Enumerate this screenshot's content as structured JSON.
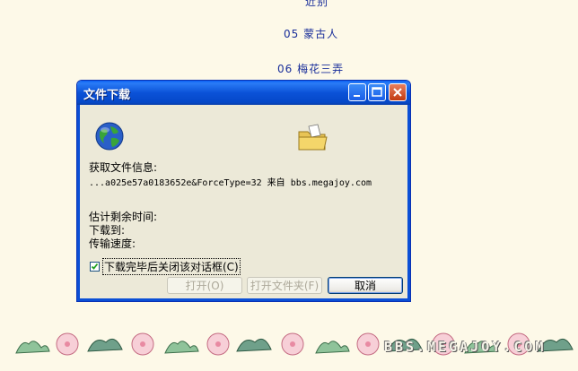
{
  "page": {
    "line_top": "近别",
    "line_05": "05 蒙古人",
    "line_06": "06 梅花三弄",
    "watermark": "BBS.MEGAJOY.COM"
  },
  "dialog": {
    "title": "文件下载",
    "info_label": "获取文件信息:",
    "source_text": "...a025e57a0183652e&ForceType=32 来自 bbs.megajoy.com",
    "time_label": "估计剩余时间:",
    "saveto_label": "下载到:",
    "rate_label": "传输速度:",
    "close_checkbox_label": "下载完毕后关闭该对话框(C)",
    "close_checkbox_checked": true,
    "open_label": "打开(O)",
    "open_folder_label": "打开文件夹(F)",
    "cancel_label": "取消"
  },
  "icons": [
    "globe-icon",
    "folder-icon",
    "minimize-icon",
    "maximize-icon",
    "close-icon",
    "checkmark-icon"
  ],
  "colors": {
    "titlebar": "#0a52d8",
    "dialog_bg": "#ece9d8",
    "page_bg": "#fdf9e8",
    "link_text": "#1a2f9a",
    "close_button": "#c23a10"
  }
}
